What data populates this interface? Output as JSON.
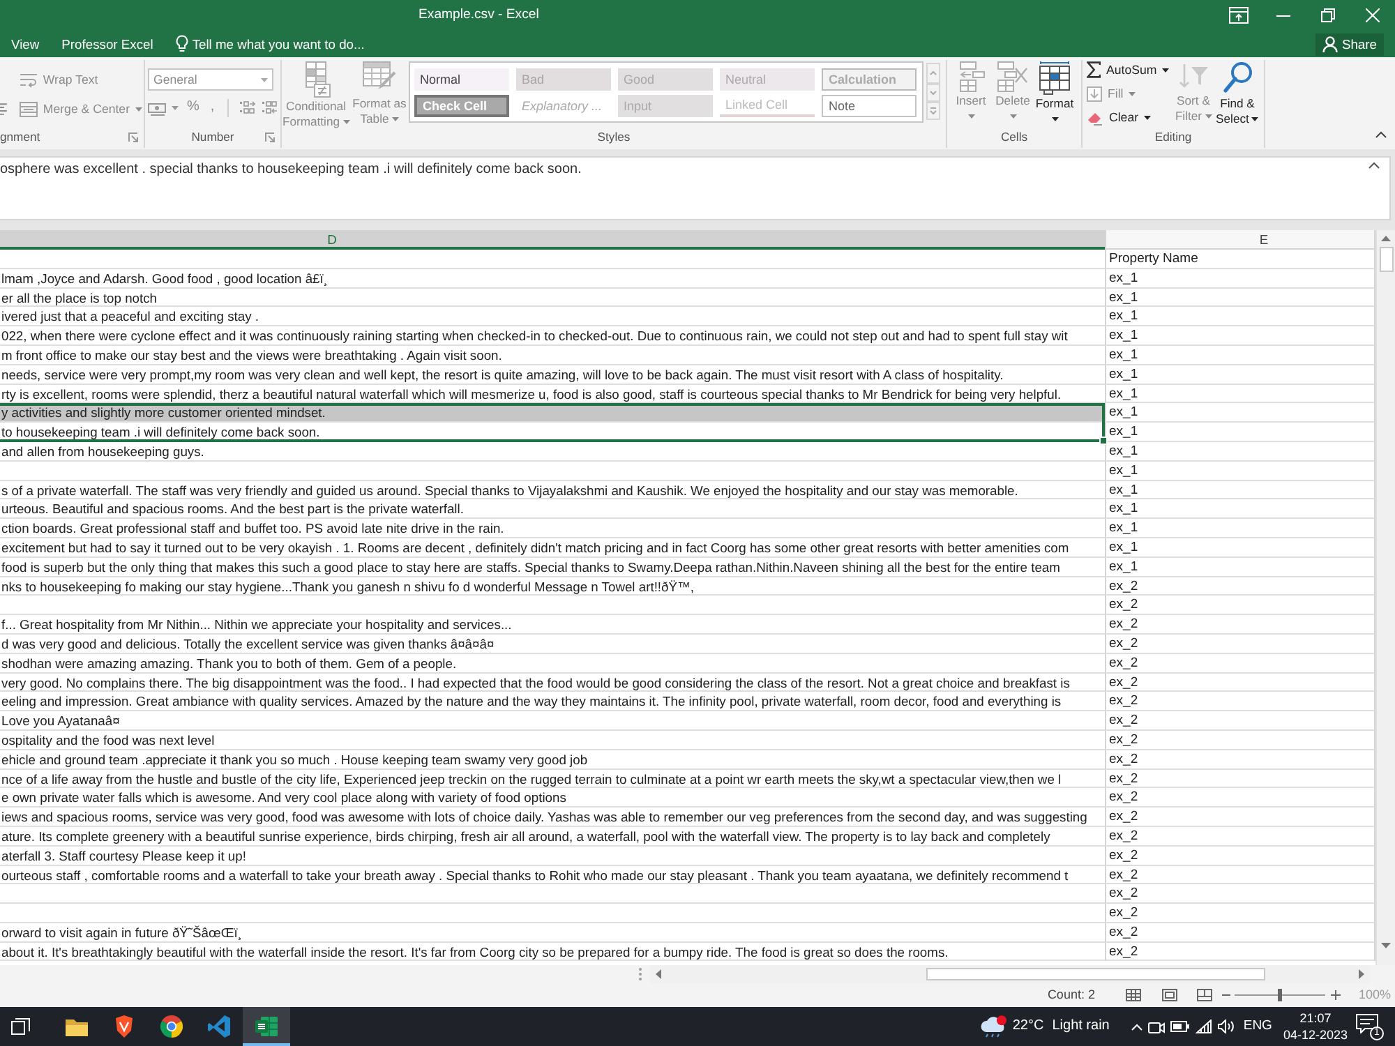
{
  "window": {
    "title": "Example.csv - Excel"
  },
  "tabs": [
    {
      "label": "View",
      "selected": false
    },
    {
      "label": "Professor Excel",
      "selected": false
    }
  ],
  "tell_me": {
    "placeholder": "Tell me what you want to do..."
  },
  "share": {
    "label": "Share"
  },
  "ribbon": {
    "alignment": {
      "label": "gnment",
      "launcher": true,
      "buttons": [
        {
          "kind": "wrap",
          "label": "Wrap Text",
          "disabled": true
        },
        {
          "kind": "merge",
          "label": "Merge & Center",
          "disabled": true,
          "dropdown": true
        }
      ]
    },
    "number": {
      "label": "Number",
      "launcher": true,
      "format": {
        "value": "General",
        "disabled": true
      },
      "buttons": [
        {
          "kind": "currency",
          "disabled": true,
          "dropdown": true
        },
        {
          "kind": "percent",
          "label": "%",
          "disabled": true
        },
        {
          "kind": "comma",
          "label": ",",
          "disabled": true
        },
        {
          "kind": "increase_decimal",
          "disabled": true
        },
        {
          "kind": "decrease_decimal",
          "disabled": true
        }
      ]
    },
    "styles": {
      "label": "Styles",
      "buttons": [
        {
          "kind": "conditional",
          "lines": [
            "Conditional",
            "Formatting"
          ],
          "disabled": true,
          "dropdown": true
        },
        {
          "kind": "table",
          "lines": [
            "Format as",
            "Table"
          ],
          "disabled": true,
          "dropdown": true
        }
      ],
      "gallery": [
        {
          "kind": "normal",
          "label": "Normal"
        },
        {
          "kind": "bad",
          "label": "Bad"
        },
        {
          "kind": "good",
          "label": "Good"
        },
        {
          "kind": "neutral",
          "label": "Neutral"
        },
        {
          "kind": "calculation",
          "label": "Calculation"
        },
        {
          "kind": "check",
          "label": "Check Cell"
        },
        {
          "kind": "explanatory",
          "label": "Explanatory ..."
        },
        {
          "kind": "input",
          "label": "Input"
        },
        {
          "kind": "linked",
          "label": "Linked Cell"
        },
        {
          "kind": "note",
          "label": "Note"
        }
      ]
    },
    "cells": {
      "label": "Cells",
      "buttons": [
        {
          "kind": "insert",
          "lines": [
            "Insert"
          ],
          "disabled": true,
          "dropdown": true
        },
        {
          "kind": "delete",
          "lines": [
            "Delete"
          ],
          "disabled": true,
          "dropdown": true
        },
        {
          "kind": "format",
          "lines": [
            "Format"
          ],
          "disabled": false,
          "dropdown": true
        }
      ]
    },
    "editing": {
      "label": "Editing",
      "buttons": [
        {
          "kind": "autosum",
          "label": "AutoSum",
          "disabled": false,
          "dropdown": true
        },
        {
          "kind": "fill",
          "label": "Fill",
          "disabled": true,
          "dropdown": true
        },
        {
          "kind": "clear",
          "label": "Clear",
          "disabled": false,
          "dropdown": true
        },
        {
          "kind": "sort",
          "lines": [
            "Sort &",
            "Filter"
          ],
          "disabled": true,
          "dropdown": true
        },
        {
          "kind": "find",
          "lines": [
            "Find &",
            "Select"
          ],
          "disabled": false,
          "dropdown": true
        }
      ]
    }
  },
  "formula_bar": {
    "value": "osphere was excellent . special thanks to housekeeping team .i will definitely come back soon."
  },
  "sheet": {
    "columns": [
      {
        "label": "D",
        "selected": true
      },
      {
        "label": "E",
        "selected": false
      }
    ],
    "rows": [
      {
        "e": "Property Name",
        "selected": false,
        "highlighted": false
      },
      {
        "d": "lmam ,Joyce and Adarsh. Good food , good location â£ï¸",
        "e": "ex_1",
        "selected": false,
        "highlighted": false
      },
      {
        "d": "er all the place is top notch",
        "e": "ex_1",
        "selected": false,
        "highlighted": false
      },
      {
        "d": "ivered just that a peaceful and exciting stay .",
        "e": "ex_1",
        "selected": false,
        "highlighted": false
      },
      {
        "d": "022, when there were cyclone effect and it was continuously raining starting when checked-in to checked-out. Due to continuous rain, we could not step out and had to spent full stay wit",
        "e": "ex_1",
        "selected": false,
        "highlighted": false
      },
      {
        "d": "m front office to make our stay best and the views were breathtaking . Again visit soon.",
        "e": "ex_1",
        "selected": false,
        "highlighted": false
      },
      {
        "d": "needs, service were very prompt,my room was very clean and well kept, the resort is quite amazing, will love to be back again. The must visit resort with A class of hospitality.",
        "e": "ex_1",
        "selected": false,
        "highlighted": false
      },
      {
        "d": "rty is excellent, rooms were splendid, therz a beautiful natural waterfall which will mesmerize u, food is also good, staff is courteous special thanks to Mr Bendrick for being very helpful.",
        "e": "ex_1",
        "selected": false,
        "highlighted": false
      },
      {
        "d": "y activities and slightly more customer oriented mindset.",
        "e": "ex_1",
        "selected": true,
        "highlighted": true
      },
      {
        "d": "to housekeeping team .i will definitely come back soon.",
        "e": "ex_1",
        "selected": true,
        "highlighted": false
      },
      {
        "d": "and allen from housekeeping guys.",
        "e": "ex_1",
        "selected": false,
        "highlighted": false
      },
      {
        "e": "ex_1",
        "selected": false,
        "highlighted": false
      },
      {
        "d": "s of a private waterfall. The staff was very friendly and guided us around. Special thanks to Vijayalakshmi and Kaushik. We enjoyed the hospitality and our stay was memorable.",
        "e": "ex_1",
        "selected": false,
        "highlighted": false
      },
      {
        "d": "urteous. Beautiful and spacious rooms. And the best part is the private waterfall.",
        "e": "ex_1",
        "selected": false,
        "highlighted": false
      },
      {
        "d": "ction boards. Great professional staff and buffet too. PS avoid late nite drive in the rain.",
        "e": "ex_1",
        "selected": false,
        "highlighted": false
      },
      {
        "d": "excitement but had to say it turned out to be very okayish . 1. Rooms are decent , definitely didn't match pricing and in fact Coorg has some other great resorts with better amenities com",
        "e": "ex_1",
        "selected": false,
        "highlighted": false
      },
      {
        "d": "food is superb but the only thing that makes this such a good place to stay here are staffs. Special thanks to Swamy.Deepa rathan.Nithin.Naveen shining all the best for the entire team",
        "e": "ex_1",
        "selected": false,
        "highlighted": false
      },
      {
        "d": "nks to housekeeping fo making our stay hygiene...Thank you ganesh n shivu fo d wonderful Message n Towel art!!ðŸ™,",
        "e": "ex_2",
        "selected": false,
        "highlighted": false
      },
      {
        "e": "ex_2",
        "selected": false,
        "highlighted": false
      },
      {
        "d": "f... Great hospitality from Mr Nithin... Nithin we appreciate your hospitality and services...",
        "e": "ex_2",
        "selected": false,
        "highlighted": false
      },
      {
        "d": "d was very good and delicious. Totally the excellent service was given thanks â¤â¤â¤",
        "e": "ex_2",
        "selected": false,
        "highlighted": false
      },
      {
        "d": "shodhan were amazing amazing. Thank you to both of them. Gem of a people.",
        "e": "ex_2",
        "selected": false,
        "highlighted": false
      },
      {
        "d": "very good. No complains there. The big disappointment was the food.. I had expected that the food would be good considering the class of the resort. Not a great choice and breakfast is",
        "e": "ex_2",
        "selected": false,
        "highlighted": false
      },
      {
        "d": "eeling and impression. Great ambiance with quality services. Amazed by the nature and the way they maintains it. The infinity pool, private waterfall, room decor, food and everything is",
        "e": "ex_2",
        "selected": false,
        "highlighted": false
      },
      {
        "d": "Love you Ayatanaâ¤",
        "e": "ex_2",
        "selected": false,
        "highlighted": false
      },
      {
        "d": "ospitality and the food was next level",
        "e": "ex_2",
        "selected": false,
        "highlighted": false
      },
      {
        "d": "ehicle and ground team .appreciate it thank you so much . House keeping team swamy very good job",
        "e": "ex_2",
        "selected": false,
        "highlighted": false
      },
      {
        "d": "nce of a life away from the hustle and bustle of the city life, Experienced jeep treckin on the rugged terrain to culminate at a point wr earth meets the sky,wt a spectacular view,then we l",
        "e": "ex_2",
        "selected": false,
        "highlighted": false
      },
      {
        "d": "e own private water falls which is awesome. And very cool place along with variety of food options",
        "e": "ex_2",
        "selected": false,
        "highlighted": false
      },
      {
        "d": "iews and spacious rooms, service was very good, food was awesome with lots of choice daily. Yashas was able to remember our veg preferences from the second day, and was suggesting",
        "e": "ex_2",
        "selected": false,
        "highlighted": false
      },
      {
        "d": "ature. Its complete greenery with a beautiful sunrise experience, birds chirping, fresh air all around, a waterfall, pool with the waterfall view. The property is to lay back and completely",
        "e": "ex_2",
        "selected": false,
        "highlighted": false
      },
      {
        "d": "aterfall 3. Staff courtesy Please keep it up!",
        "e": "ex_2",
        "selected": false,
        "highlighted": false
      },
      {
        "d": "ourteous staff , comfortable rooms and a waterfall to take your breath away . Special thanks to Rohit who made our stay pleasant . Thank you team ayaatana, we definitely recommend t",
        "e": "ex_2",
        "selected": false,
        "highlighted": false
      },
      {
        "e": "ex_2",
        "selected": false,
        "highlighted": false
      },
      {
        "e": "ex_2",
        "selected": false,
        "highlighted": false
      },
      {
        "d": "orward to visit again in future ðŸ˜ŠâœŒï¸",
        "e": "ex_2",
        "selected": false,
        "highlighted": false
      },
      {
        "d": "about it. It's breathtakingly beautiful with the waterfall inside the resort. It's far from Coorg city so be prepared for a bumpy ride. The food is great so does the rooms.",
        "e": "ex_2",
        "selected": false,
        "highlighted": false
      }
    ]
  },
  "status_bar": {
    "count": "Count: 2",
    "zoom_slider": {
      "level": 0.5
    },
    "zoom": "100%"
  },
  "taskbar": {
    "apps": [
      {
        "kind": "taskview",
        "selected": false
      },
      {
        "kind": "folder",
        "selected": false
      },
      {
        "kind": "shield",
        "selected": false
      },
      {
        "kind": "browser",
        "selected": false
      },
      {
        "kind": "code",
        "selected": false
      },
      {
        "kind": "sheet",
        "selected": true
      }
    ],
    "weather": {
      "temperature": "22°C",
      "condition": "Light rain"
    },
    "language": "ENG",
    "time": "21:07",
    "date": "04-12-2023",
    "notifications": "1"
  }
}
